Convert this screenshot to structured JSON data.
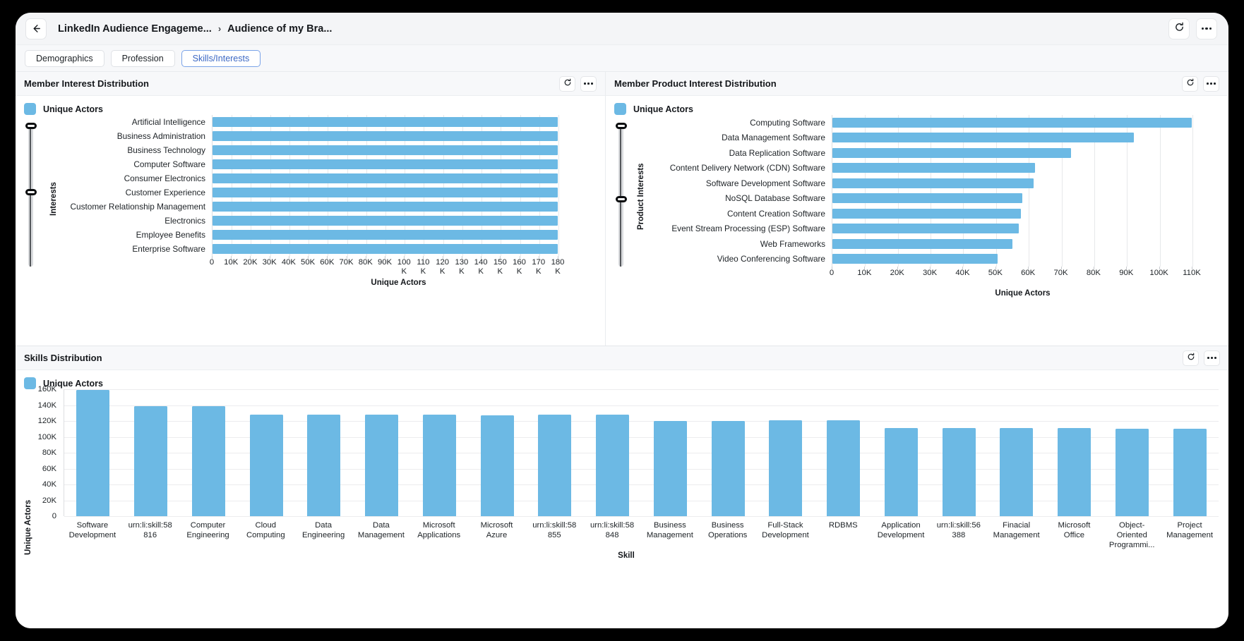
{
  "header": {
    "back_icon": "arrow-left-icon",
    "breadcrumb_parent": "LinkedIn Audience Engageme...",
    "breadcrumb_separator": "›",
    "breadcrumb_current": "Audience of my Bra...",
    "refresh_icon": "refresh-icon",
    "more_icon": "more-options-icon"
  },
  "tabs": [
    {
      "label": "Demographics",
      "active": false
    },
    {
      "label": "Profession",
      "active": false
    },
    {
      "label": "Skills/Interests",
      "active": true
    }
  ],
  "colors": {
    "bar": "#6cb9e4",
    "active_tab_text": "#3c68c4",
    "panel_header_bg": "#f7f8fa"
  },
  "panels": {
    "member_interest": {
      "title": "Member Interest Distribution",
      "legend": "Unique Actors",
      "refresh_icon": "refresh-icon",
      "more_icon": "more-options-icon"
    },
    "product_interest": {
      "title": "Member Product Interest Distribution",
      "legend": "Unique Actors",
      "refresh_icon": "refresh-icon",
      "more_icon": "more-options-icon"
    },
    "skills": {
      "title": "Skills Distribution",
      "legend": "Unique Actors",
      "refresh_icon": "refresh-icon",
      "more_icon": "more-options-icon"
    }
  },
  "chart_data": [
    {
      "id": "member_interest",
      "type": "bar",
      "orientation": "horizontal",
      "title": "Member Interest Distribution",
      "xlabel": "Unique Actors",
      "ylabel": "Interests",
      "legend": [
        "Unique Actors"
      ],
      "legend_position": "top-left",
      "grid": true,
      "xlim": [
        0,
        180000
      ],
      "xticks": [
        0,
        10000,
        20000,
        30000,
        40000,
        50000,
        60000,
        70000,
        80000,
        90000,
        100000,
        110000,
        120000,
        130000,
        140000,
        150000,
        160000,
        170000,
        180000
      ],
      "xticklabels": [
        "0",
        "10K",
        "20K",
        "30K",
        "40K",
        "50K",
        "60K",
        "70K",
        "80K",
        "90K",
        "100 K",
        "110 K",
        "120 K",
        "130 K",
        "140 K",
        "150 K",
        "160 K",
        "170 K",
        "180 K"
      ],
      "categories": [
        "Artificial Intelligence",
        "Business Administration",
        "Business Technology",
        "Computer Software",
        "Consumer Electronics",
        "Customer Experience",
        "Customer Relationship Management",
        "Electronics",
        "Employee Benefits",
        "Enterprise Software"
      ],
      "values": [
        180000,
        180000,
        180000,
        180000,
        180000,
        180000,
        180000,
        180000,
        180000,
        180000
      ]
    },
    {
      "id": "product_interest",
      "type": "bar",
      "orientation": "horizontal",
      "title": "Member Product Interest Distribution",
      "xlabel": "Unique Actors",
      "ylabel": "Product Interests",
      "legend": [
        "Unique Actors"
      ],
      "legend_position": "top-left",
      "grid": true,
      "xlim": [
        0,
        110000
      ],
      "xticks": [
        0,
        10000,
        20000,
        30000,
        40000,
        50000,
        60000,
        70000,
        80000,
        90000,
        100000,
        110000
      ],
      "xticklabels": [
        "0",
        "10K",
        "20K",
        "30K",
        "40K",
        "50K",
        "60K",
        "70K",
        "80K",
        "90K",
        "100K",
        "110K"
      ],
      "categories": [
        "Computing Software",
        "Data Management Software",
        "Data Replication Software",
        "Content Delivery Network (CDN) Software",
        "Software Development Software",
        "NoSQL Database Software",
        "Content Creation Software",
        "Event Stream Processing (ESP) Software",
        "Web Frameworks",
        "Video Conferencing Software"
      ],
      "values": [
        110000,
        92000,
        73000,
        62000,
        61500,
        58000,
        57500,
        57000,
        55000,
        50500
      ]
    },
    {
      "id": "skills",
      "type": "bar",
      "orientation": "vertical",
      "title": "Skills Distribution",
      "xlabel": "Skill",
      "ylabel": "Unique Actors",
      "legend": [
        "Unique Actors"
      ],
      "legend_position": "top-left",
      "grid": true,
      "ylim": [
        0,
        160000
      ],
      "yticks": [
        0,
        20000,
        40000,
        60000,
        80000,
        100000,
        120000,
        140000,
        160000
      ],
      "yticklabels": [
        "0",
        "20K",
        "40K",
        "60K",
        "80K",
        "100K",
        "120K",
        "140K",
        "160K"
      ],
      "categories": [
        "Software Development",
        "urn:li:skill:58816",
        "Computer Engineering",
        "Cloud Computing",
        "Data Engineering",
        "Data Management",
        "Microsoft Applications",
        "Microsoft Azure",
        "urn:li:skill:58855",
        "urn:li:skill:58848",
        "Business Management",
        "Business Operations",
        "Full-Stack Development",
        "RDBMS",
        "Application Development",
        "urn:li:skill:56388",
        "Finacial Management",
        "Microsoft Office",
        "Object-Oriented Programmi...",
        "Project Management"
      ],
      "values": [
        159000,
        139000,
        139000,
        128000,
        128000,
        128000,
        128000,
        127000,
        128000,
        128000,
        120000,
        120000,
        121000,
        121000,
        111000,
        111000,
        111000,
        111000,
        110000,
        110000
      ]
    }
  ]
}
